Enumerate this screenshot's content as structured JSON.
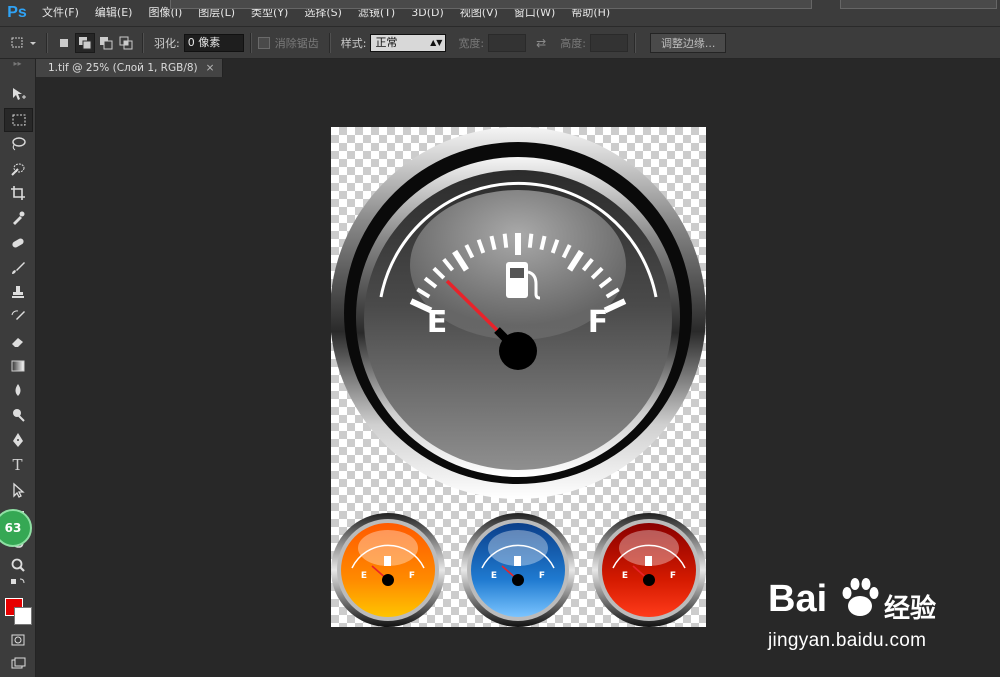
{
  "app": {
    "logo": "Ps",
    "accent": "#2fa3f6"
  },
  "menu": [
    "文件(F)",
    "编辑(E)",
    "图像(I)",
    "图层(L)",
    "类型(Y)",
    "选择(S)",
    "滤镜(T)",
    "3D(D)",
    "视图(V)",
    "窗口(W)",
    "帮助(H)"
  ],
  "options": {
    "feather_label": "羽化:",
    "feather_value": "0 像素",
    "antialias_label": "消除锯齿",
    "style_label": "样式:",
    "style_value": "正常",
    "width_label": "宽度:",
    "height_label": "高度:",
    "refine_edge": "调整边缘..."
  },
  "document_tab": {
    "title": "1.tif @ 25% (Слой 1, RGB/8)",
    "close": "×"
  },
  "toolbar": {
    "tools": [
      "move-icon",
      "marquee-icon",
      "lasso-icon",
      "quick-select-icon",
      "crop-icon",
      "eyedropper-icon",
      "healing-icon",
      "brush-icon",
      "stamp-icon",
      "history-brush-icon",
      "eraser-icon",
      "gradient-icon",
      "blur-icon",
      "dodge-icon",
      "pen-icon",
      "type-icon",
      "path-select-icon",
      "shape-icon",
      "hand-icon",
      "zoom-icon"
    ],
    "active_tool": "marquee-icon",
    "foreground_color": "#e60000",
    "background_color": "#ffffff",
    "badge": "63"
  },
  "artwork": {
    "main_gauge": {
      "empty_label": "E",
      "full_label": "F"
    },
    "small_gauges": [
      {
        "color": "orange",
        "empty_label": "E",
        "full_label": "F"
      },
      {
        "color": "blue",
        "empty_label": "E",
        "full_label": "F"
      },
      {
        "color": "red",
        "empty_label": "E",
        "full_label": "F"
      }
    ]
  },
  "watermark": {
    "brand_left": "Bai",
    "brand_right": "经验",
    "url": "jingyan.baidu.com"
  }
}
